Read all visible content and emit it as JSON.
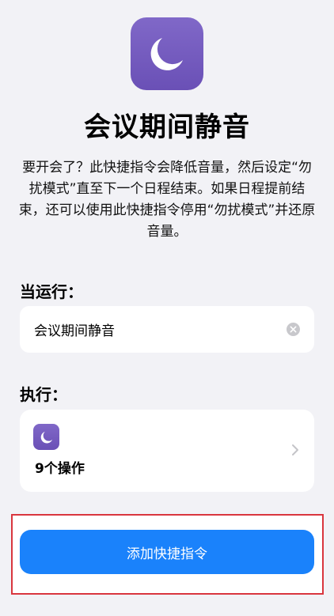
{
  "shortcut": {
    "title": "会议期间静音",
    "description": "要开会了？此快捷指令会降低音量，然后设定“勿扰模式”直至下一个日程结束。如果日程提前结束，还可以使用此快捷指令停用“勿扰模式”并还原音量。",
    "icon": "moon-icon",
    "accent_color": "#7559bd"
  },
  "trigger": {
    "label": "当运行：",
    "value": "会议期间静音"
  },
  "action": {
    "label": "执行：",
    "count_text": "9个操作"
  },
  "add_button": {
    "label": "添加快捷指令",
    "color": "#1a82fb"
  },
  "highlight_color": "#d9363e"
}
